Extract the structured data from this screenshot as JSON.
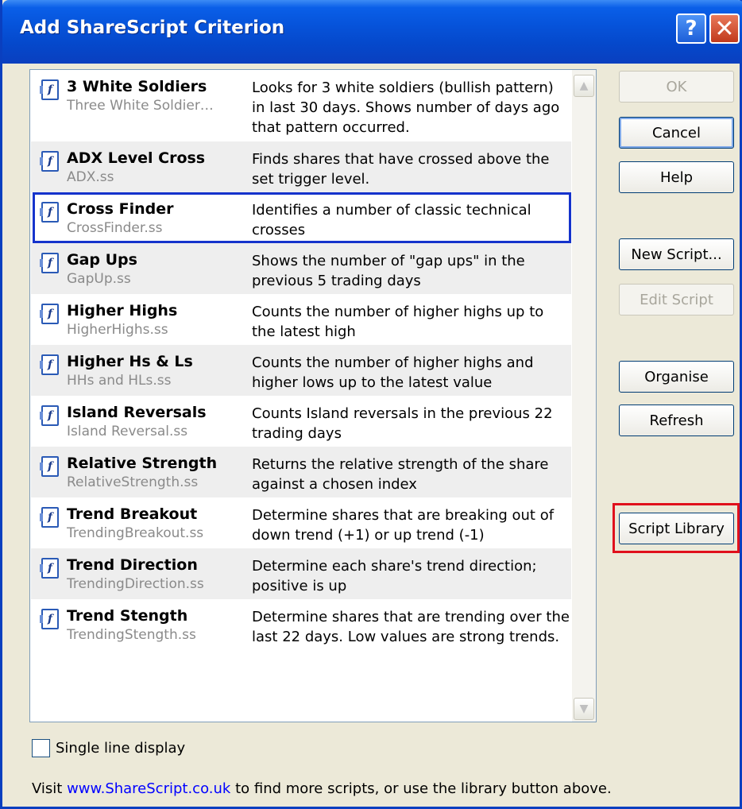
{
  "window": {
    "title": "Add ShareScript Criterion"
  },
  "titlebar": {
    "help_glyph": "?",
    "close_glyph": "✕"
  },
  "list": {
    "items": [
      {
        "name": "3 White Soldiers",
        "file": "Three White Soldier…",
        "desc": "Looks for 3 white soldiers (bullish pattern) in last 30 days. Shows number of days ago that pattern occurred."
      },
      {
        "name": "ADX Level Cross",
        "file": "ADX.ss",
        "desc": "Finds shares that have crossed above the set trigger level."
      },
      {
        "name": "Cross Finder",
        "file": "CrossFinder.ss",
        "desc": "Identifies a number of classic technical crosses"
      },
      {
        "name": "Gap Ups",
        "file": "GapUp.ss",
        "desc": "Shows the number of \"gap ups\" in the previous 5 trading days"
      },
      {
        "name": "Higher Highs",
        "file": "HigherHighs.ss",
        "desc": "Counts the number of higher highs up to the latest high"
      },
      {
        "name": "Higher Hs & Ls",
        "file": "HHs and HLs.ss",
        "desc": "Counts the number of higher highs and higher lows up to the latest value"
      },
      {
        "name": "Island Reversals",
        "file": "Island Reversal.ss",
        "desc": "Counts Island reversals in the previous 22 trading days"
      },
      {
        "name": "Relative Strength",
        "file": "RelativeStrength.ss",
        "desc": "Returns the relative strength of the share against a chosen index"
      },
      {
        "name": "Trend Breakout",
        "file": "TrendingBreakout.ss",
        "desc": "Determine shares that are breaking out of down trend (+1) or up trend (-1)"
      },
      {
        "name": "Trend Direction",
        "file": "TrendingDirection.ss",
        "desc": "Determine each share's trend direction; positive is up"
      },
      {
        "name": "Trend Stength",
        "file": "TrendingStength.ss",
        "desc": "Determine shares that are trending over the last 22 days. Low values are strong trends."
      }
    ],
    "selected_index": 2,
    "icon": "script-function-icon",
    "icon_glyph": "f"
  },
  "buttons": {
    "ok": "OK",
    "cancel": "Cancel",
    "help": "Help",
    "new_script": "New Script...",
    "edit_script": "Edit Script",
    "organise": "Organise",
    "refresh": "Refresh",
    "script_library": "Script Library"
  },
  "options": {
    "single_line_label": "Single line display",
    "single_line_checked": false
  },
  "footer": {
    "prefix": "Visit ",
    "link": "www.ShareScript.co.uk",
    "suffix": " to find more scripts, or use the library button above."
  },
  "colors": {
    "titlebar": "#0a5fe8",
    "selection_border": "#1533cc",
    "highlight_frame": "#e0101c",
    "link": "#0000ff"
  }
}
